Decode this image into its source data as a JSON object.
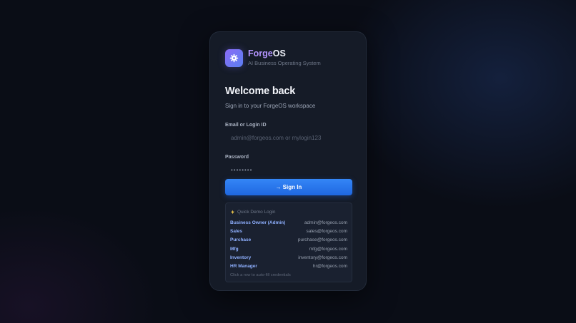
{
  "brand": {
    "name_part1": "Forge",
    "name_part2": "OS",
    "tagline": "AI Business Operating System",
    "logo_icon": "gear-icon"
  },
  "login": {
    "title": "Welcome back",
    "subtitle": "Sign in to your ForgeOS workspace",
    "email_label": "Email or Login ID",
    "email_placeholder": "admin@forgeos.com or mylogin123",
    "email_value": "",
    "password_label": "Password",
    "password_placeholder": "••••••••",
    "password_value": "",
    "signin_arrow": "→",
    "signin_label": "Sign In"
  },
  "demo": {
    "header_icon": "lightning-icon",
    "header": "Quick Demo Login",
    "accounts": [
      {
        "role": "Business Owner (Admin)",
        "email": "admin@forgeos.com"
      },
      {
        "role": "Sales",
        "email": "sales@forgeos.com"
      },
      {
        "role": "Purchase",
        "email": "purchase@forgeos.com"
      },
      {
        "role": "Mfg",
        "email": "mfg@forgeos.com"
      },
      {
        "role": "Inventory",
        "email": "inventory@forgeos.com"
      },
      {
        "role": "HR Manager",
        "email": "hr@forgeos.com"
      }
    ],
    "hint": "Click a row to auto-fill credentials"
  },
  "colors": {
    "accent": "#2f7ef2",
    "brand_purple": "#b394ff",
    "card_bg": "#151b27",
    "page_bg": "#0a0d16"
  }
}
